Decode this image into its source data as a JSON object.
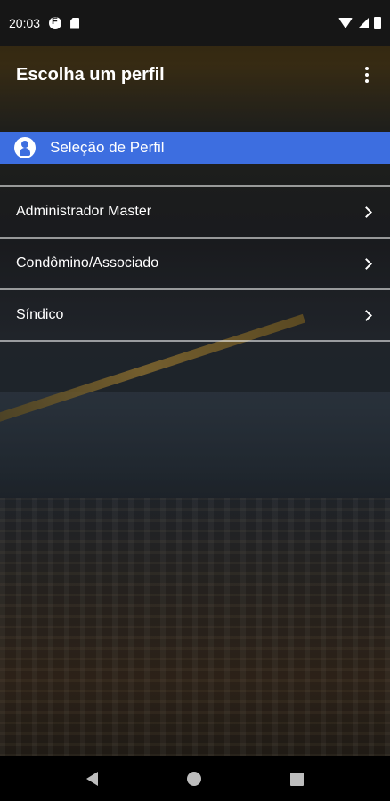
{
  "status_bar": {
    "time": "20:03",
    "left_icons": [
      "f-icon",
      "sd-card-icon"
    ],
    "right_icons": [
      "wifi-icon",
      "signal-icon",
      "battery-icon"
    ]
  },
  "app_bar": {
    "title": "Escolha um perfil",
    "menu_icon": "more-vert-icon"
  },
  "section": {
    "title": "Seleção de Perfil",
    "icon": "user-icon",
    "color": "#3d6ee0"
  },
  "profiles": [
    {
      "label": "Administrador Master"
    },
    {
      "label": "Condômino/Associado"
    },
    {
      "label": "Síndico"
    }
  ],
  "nav_bar": {
    "buttons": [
      "back",
      "home",
      "recent-apps"
    ]
  }
}
